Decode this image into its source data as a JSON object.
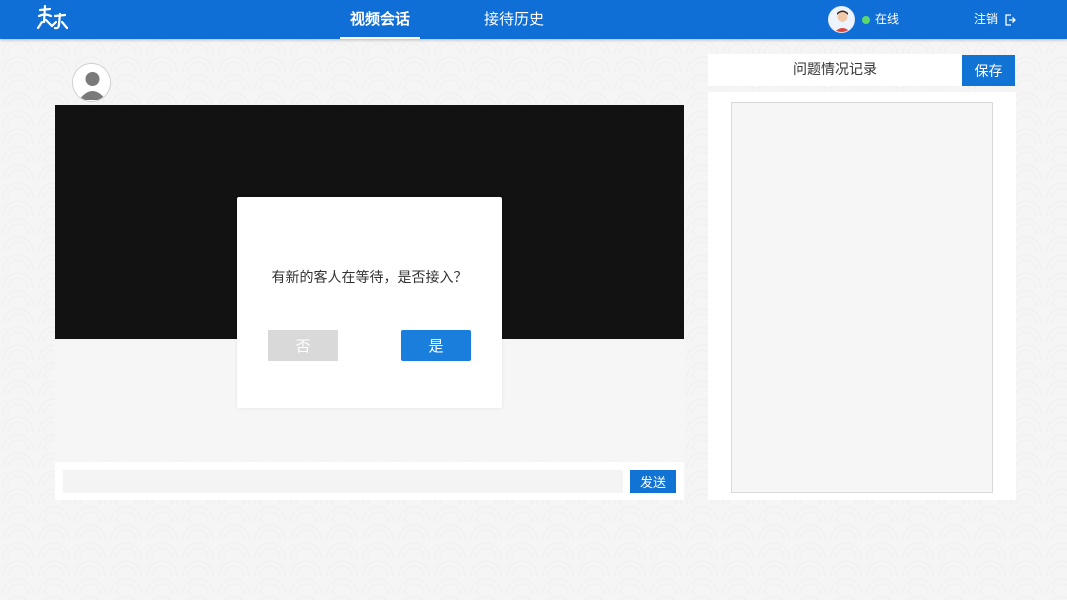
{
  "header": {
    "logo_icon": "calligraphy-logo-icon",
    "tabs": [
      {
        "label": "视频会话",
        "active": true
      },
      {
        "label": "接待历史",
        "active": false
      }
    ],
    "user": {
      "avatar_icon": "user-photo-icon",
      "status_text": "在线",
      "status_color": "#5bd96b"
    },
    "logout_label": "注销",
    "logout_icon": "logout-icon",
    "bar_color": "#0f6fd6"
  },
  "session": {
    "peer_avatar_icon": "default-user-avatar-icon",
    "message_input": {
      "value": "",
      "placeholder": ""
    },
    "send_label": "发送"
  },
  "notes": {
    "title": "问题情况记录",
    "save_label": "保存",
    "content": ""
  },
  "dialog": {
    "message": "有新的客人在等待，是否接入？",
    "no_label": "否",
    "yes_label": "是"
  },
  "accent_color": "#1173d4"
}
